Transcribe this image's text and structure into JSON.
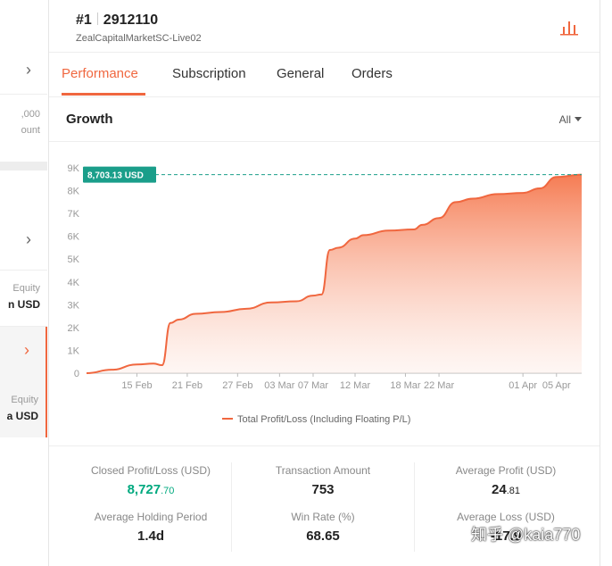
{
  "sidebar": {
    "row1_partial": ",000",
    "row2_partial": "ount",
    "equity1_label": "Equity",
    "equity1_value": "n USD",
    "equity2_label": "Equity",
    "equity2_value": "a USD"
  },
  "header": {
    "rank": "#1",
    "account_id": "2912110",
    "server": "ZealCapitalMarketSC-Live02"
  },
  "tabs": [
    {
      "label": "Performance",
      "active": true
    },
    {
      "label": "Subscription",
      "active": false
    },
    {
      "label": "General",
      "active": false
    },
    {
      "label": "Orders",
      "active": false
    }
  ],
  "section": {
    "title": "Growth",
    "range_label": "All"
  },
  "chart_data": {
    "type": "area",
    "title": "",
    "current_label": "8,703.13 USD",
    "current_value": 8703.13,
    "y_ticks": [
      "0",
      "1K",
      "2K",
      "3K",
      "4K",
      "5K",
      "6K",
      "7K",
      "8K",
      "9K"
    ],
    "ylim": [
      0,
      9000
    ],
    "x_ticks": [
      "15 Feb",
      "21 Feb",
      "27 Feb",
      "03 Mar",
      "07 Mar",
      "12 Mar",
      "18 Mar",
      "22 Mar",
      "01 Apr",
      "05 Apr"
    ],
    "series": [
      {
        "name": "Total Profit/Loss (Including Floating P/L)",
        "color": "#f0673f",
        "points": [
          {
            "x": "09 Feb",
            "y": 0
          },
          {
            "x": "12 Feb",
            "y": 150
          },
          {
            "x": "15 Feb",
            "y": 380
          },
          {
            "x": "17 Feb",
            "y": 420
          },
          {
            "x": "18 Feb",
            "y": 350
          },
          {
            "x": "19 Feb",
            "y": 2200
          },
          {
            "x": "20 Feb",
            "y": 2350
          },
          {
            "x": "22 Feb",
            "y": 2600
          },
          {
            "x": "25 Feb",
            "y": 2680
          },
          {
            "x": "28 Feb",
            "y": 2820
          },
          {
            "x": "02 Mar",
            "y": 3100
          },
          {
            "x": "05 Mar",
            "y": 3150
          },
          {
            "x": "07 Mar",
            "y": 3400
          },
          {
            "x": "08 Mar",
            "y": 3450
          },
          {
            "x": "09 Mar",
            "y": 5400
          },
          {
            "x": "10 Mar",
            "y": 5500
          },
          {
            "x": "12 Mar",
            "y": 5900
          },
          {
            "x": "13 Mar",
            "y": 6050
          },
          {
            "x": "16 Mar",
            "y": 6250
          },
          {
            "x": "19 Mar",
            "y": 6300
          },
          {
            "x": "20 Mar",
            "y": 6500
          },
          {
            "x": "22 Mar",
            "y": 6800
          },
          {
            "x": "24 Mar",
            "y": 7500
          },
          {
            "x": "26 Mar",
            "y": 7650
          },
          {
            "x": "29 Mar",
            "y": 7850
          },
          {
            "x": "01 Apr",
            "y": 7900
          },
          {
            "x": "03 Apr",
            "y": 8100
          },
          {
            "x": "05 Apr",
            "y": 8600
          },
          {
            "x": "08 Apr",
            "y": 8703.13
          }
        ]
      }
    ]
  },
  "legend_label": "Total Profit/Loss (Including Floating P/L)",
  "stats": {
    "closed_pl_label": "Closed Profit/Loss (USD)",
    "closed_pl_int": "8,727",
    "closed_pl_dec": ".70",
    "transaction_label": "Transaction Amount",
    "transaction_value": "753",
    "avg_profit_label": "Average Profit (USD)",
    "avg_profit_int": "24",
    "avg_profit_dec": ".81",
    "avg_holding_label": "Average Holding Period",
    "avg_holding_value": "1.4d",
    "win_rate_label": "Win Rate (%)",
    "win_rate_value": "68.65",
    "avg_loss_label": "Average Loss (USD)",
    "avg_loss_value": "-17.9"
  },
  "watermark": "知乎 @kaia770"
}
